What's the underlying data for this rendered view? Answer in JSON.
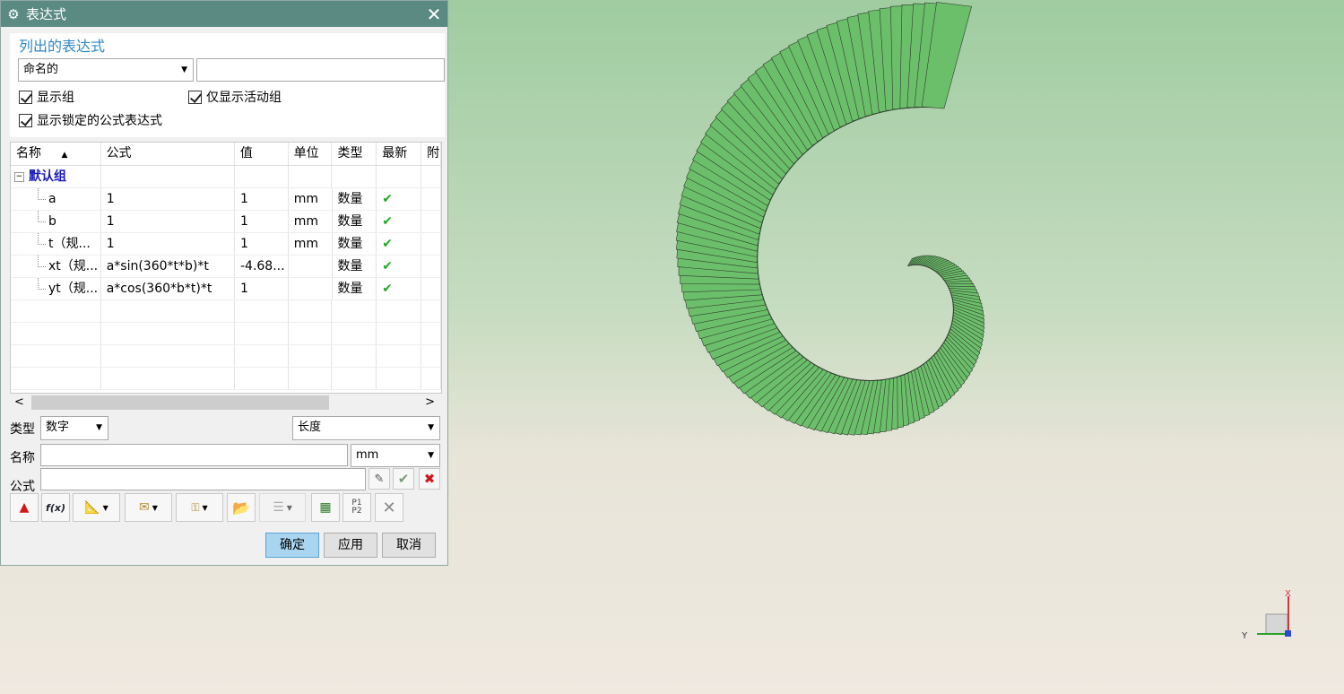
{
  "dialog": {
    "title": "表达式",
    "section_title": "列出的表达式",
    "filter_combo": "命名的",
    "filter_text": "",
    "checkboxes": {
      "show_groups": "显示组",
      "active_only": "仅显示活动组",
      "show_locked": "显示锁定的公式表达式"
    },
    "table": {
      "headers": [
        "名称",
        "公式",
        "值",
        "单位",
        "类型",
        "最新",
        "附"
      ],
      "group": "默认组",
      "rows": [
        {
          "name": "a",
          "formula": "1",
          "value": "1",
          "unit": "mm",
          "type": "数量",
          "uptodate": "✔"
        },
        {
          "name": "b",
          "formula": "1",
          "value": "1",
          "unit": "mm",
          "type": "数量",
          "uptodate": "✔"
        },
        {
          "name": "t（规...",
          "formula": "1",
          "value": "1",
          "unit": "mm",
          "type": "数量",
          "uptodate": "✔"
        },
        {
          "name": "xt（规...",
          "formula": "a*sin(360*t*b)*t",
          "value": "-4.68...",
          "unit": "",
          "type": "数量",
          "uptodate": "✔"
        },
        {
          "name": "yt（规...",
          "formula": "a*cos(360*b*t)*t",
          "value": "1",
          "unit": "",
          "type": "数量",
          "uptodate": "✔"
        }
      ]
    },
    "type_label": "类型",
    "type_value": "数字",
    "dimension_value": "长度",
    "name_label": "名称",
    "name_value": "",
    "unit_value": "mm",
    "formula_label": "公式",
    "formula_value": "",
    "buttons": {
      "ok": "确定",
      "apply": "应用",
      "cancel": "取消"
    }
  },
  "csys": {
    "x_label": "X",
    "y_label": "Y"
  },
  "colors": {
    "titlebar": "#5a8a82",
    "section_title": "#2e87c4",
    "shape_fill": "#6cbf6a",
    "shape_edge": "#2f3a2f"
  }
}
